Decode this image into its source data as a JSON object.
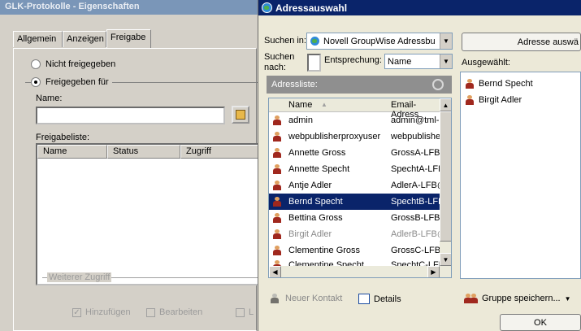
{
  "back_window": {
    "title": "GLK-Protokolle - Eigenschaften",
    "tabs": [
      "Allgemein",
      "Anzeigen",
      "Freigabe"
    ],
    "active_tab": "Freigabe",
    "radio_not_shared": "Nicht freigegeben",
    "radio_shared_for": "Freigegeben für",
    "name_label": "Name:",
    "name_value": "",
    "share_list_label": "Freigabeliste:",
    "share_columns": [
      "Name",
      "Status",
      "Zugriff"
    ],
    "more_access_label": "Weiterer Zugriff",
    "checkboxes": [
      {
        "label": "Hinzufügen",
        "checked": true
      },
      {
        "label": "Bearbeiten",
        "checked": false
      },
      {
        "label": "L",
        "checked": false
      }
    ]
  },
  "front_window": {
    "title": "Adressauswahl",
    "search_in_label": "Suchen in:",
    "search_in_value": "Novell GroupWise Adressbu",
    "search_for_label_1": "Suchen",
    "search_for_label_2": "nach:",
    "match_label": "Entsprechung:",
    "match_value": "Name",
    "select_address_button": "Adresse auswä",
    "selected_label": "Ausgewählt:",
    "address_list_label": "Adressliste:",
    "columns": [
      "Name",
      "Email-Adress"
    ],
    "contacts": [
      {
        "name": "admin",
        "email": "admin@tml-3"
      },
      {
        "name": "webpublisherproxyuser",
        "email": "webpublishe"
      },
      {
        "name": "Annette Gross",
        "email": "GrossA-LFB@"
      },
      {
        "name": "Annette Specht",
        "email": "SpechtA-LFE"
      },
      {
        "name": "Antje Adler",
        "email": "AdlerA-LFB@"
      },
      {
        "name": "Bernd Specht",
        "email": "SpechtB-LFB",
        "selected": true
      },
      {
        "name": "Bettina Gross",
        "email": "GrossB-LFB@"
      },
      {
        "name": "Birgit Adler",
        "email": "AdlerB-LFB@",
        "greyed": true
      },
      {
        "name": "Clementine Gross",
        "email": "GrossC-LFB@"
      },
      {
        "name": "Clementine Specht",
        "email": "SpechtC-LFE"
      }
    ],
    "selected_people": [
      "Bernd Specht",
      "Birgit Adler"
    ],
    "new_contact": "Neuer Kontakt",
    "details": "Details",
    "save_group": "Gruppe speichern...",
    "ok": "OK"
  },
  "colors": {
    "title_active": "#0a246a",
    "title_inactive": "#7a96b8",
    "selection": "#0a246a"
  }
}
